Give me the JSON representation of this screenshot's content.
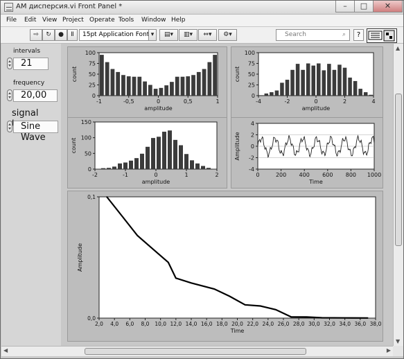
{
  "window": {
    "title": "AM дисперсия.vi Front Panel *",
    "buttons": [
      "–",
      "□",
      "✕"
    ]
  },
  "menu": {
    "items": [
      "File",
      "Edit",
      "View",
      "Project",
      "Operate",
      "Tools",
      "Window",
      "Help"
    ]
  },
  "toolbar": {
    "font": "15pt Application Font",
    "search_placeholder": "Search",
    "help": "?"
  },
  "controls": {
    "intervals": {
      "label": "intervals",
      "value": "21"
    },
    "frequency": {
      "label": "frequency",
      "value": "20,00"
    },
    "signal_type": {
      "label": "signal type",
      "value": "Sine Wave"
    }
  },
  "chart_data": [
    {
      "type": "bar",
      "xlabel": "amplitude",
      "ylabel": "count",
      "xlim": [
        -1,
        1
      ],
      "ylim": [
        0,
        100
      ],
      "xticks": [
        "-1",
        "-0,5",
        "0",
        "0,5",
        "1"
      ],
      "yticks": [
        "0",
        "25",
        "50",
        "75",
        "100"
      ],
      "values": [
        95,
        78,
        62,
        55,
        48,
        45,
        44,
        44,
        33,
        25,
        16,
        18,
        24,
        32,
        44,
        44,
        45,
        48,
        55,
        62,
        78,
        95
      ]
    },
    {
      "type": "bar",
      "xlabel": "amplitude",
      "ylabel": "count",
      "xlim": [
        -4,
        4
      ],
      "ylim": [
        0,
        100
      ],
      "xticks": [
        "-4",
        "-2",
        "0",
        "2",
        "4"
      ],
      "yticks": [
        "0",
        "25",
        "50",
        "75",
        "100"
      ],
      "values": [
        1,
        5,
        8,
        12,
        30,
        37,
        60,
        74,
        60,
        75,
        70,
        75,
        59,
        74,
        60,
        72,
        65,
        42,
        34,
        16,
        8,
        2
      ]
    },
    {
      "type": "bar",
      "xlabel": "amplitude",
      "ylabel": "count",
      "xlim": [
        -2,
        2
      ],
      "ylim": [
        0,
        150
      ],
      "xticks": [
        "-2",
        "-1",
        "0",
        "1",
        "2"
      ],
      "yticks": [
        "0",
        "50",
        "100",
        "150"
      ],
      "values": [
        1,
        3,
        4,
        8,
        18,
        21,
        27,
        35,
        49,
        71,
        99,
        103,
        119,
        123,
        93,
        76,
        48,
        28,
        18,
        10,
        4,
        1
      ]
    },
    {
      "type": "line",
      "xlabel": "Time",
      "ylabel": "Amplitude",
      "xlim": [
        0,
        1000
      ],
      "ylim": [
        -4,
        4
      ],
      "xticks": [
        "0",
        "200",
        "400",
        "600",
        "800",
        "1000"
      ],
      "yticks": [
        "-4",
        "-2",
        "0",
        "2",
        "4"
      ],
      "series_description": "noisy periodic signal",
      "envelope": [
        -2,
        2
      ]
    },
    {
      "type": "line",
      "xlabel": "Time",
      "ylabel": "Amplitude",
      "xlim": [
        2,
        38
      ],
      "ylim": [
        0,
        0.1
      ],
      "xticks": [
        "2,0",
        "4,0",
        "6,0",
        "8,0",
        "10,0",
        "12,0",
        "14,0",
        "16,0",
        "18,0",
        "20,0",
        "22,0",
        "24,0",
        "26,0",
        "28,0",
        "30,0",
        "32,0",
        "34,0",
        "36,0",
        "38,0"
      ],
      "yticks": [
        "0,0",
        "0,1"
      ],
      "x": [
        3,
        5,
        7,
        9,
        11,
        12,
        14,
        17,
        19,
        21,
        23,
        25,
        27,
        29,
        31,
        34,
        37
      ],
      "y": [
        0.1,
        0.084,
        0.068,
        0.057,
        0.046,
        0.033,
        0.029,
        0.024,
        0.018,
        0.011,
        0.01,
        0.007,
        0.001,
        0.0009,
        0.0003,
        0.0002,
        0.0001
      ]
    }
  ]
}
